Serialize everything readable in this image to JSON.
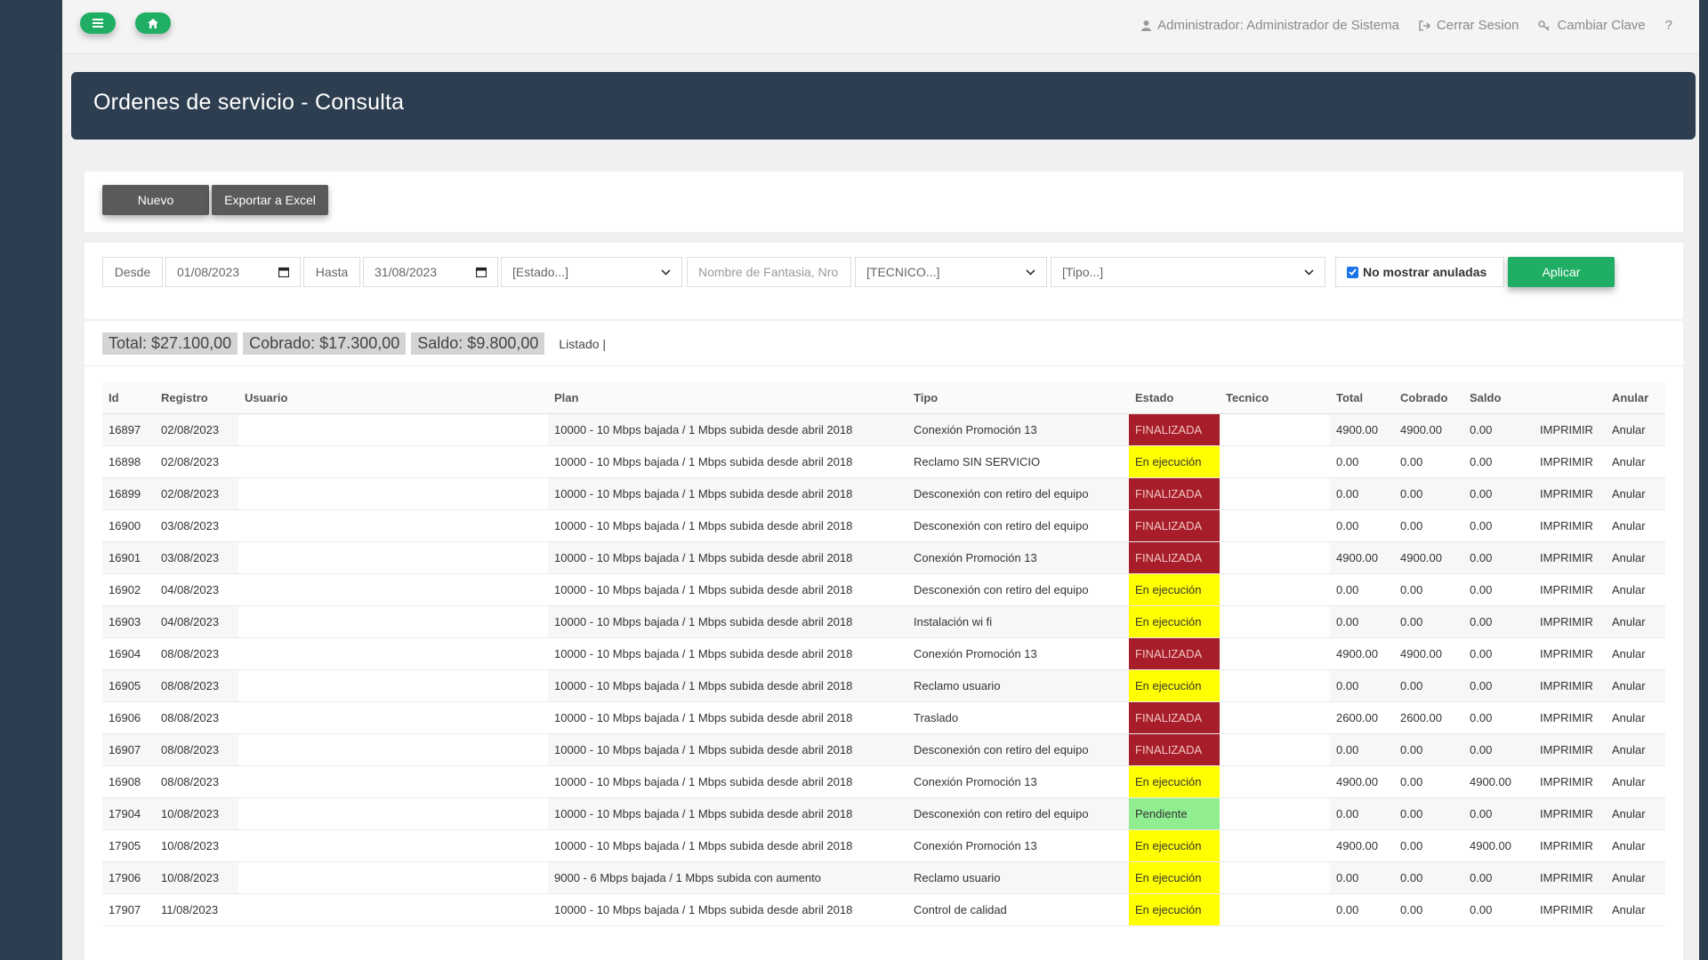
{
  "topnav": {
    "user": "Administrador: Administrador de Sistema",
    "logout": "Cerrar Sesion",
    "change_password": "Cambiar Clave",
    "help": "?"
  },
  "page": {
    "title": "Ordenes de servicio - Consulta"
  },
  "actions": {
    "new": "Nuevo",
    "export": "Exportar a Excel"
  },
  "filters": {
    "desde_label": "Desde",
    "desde_value": "01/08/2023",
    "hasta_label": "Hasta",
    "hasta_value": "31/08/2023",
    "estado": "[Estado...]",
    "search_placeholder": "Nombre de Fantasia, Nro",
    "tecnico": "[TECNICO...]",
    "tipo": "[Tipo...]",
    "no_anuladas": "No mostrar anuladas",
    "apply": "Aplicar"
  },
  "summary": {
    "total": "Total: $27.100,00",
    "cobrado": "Cobrado: $17.300,00",
    "saldo": "Saldo: $9.800,00",
    "listado": "Listado |"
  },
  "table": {
    "headers": {
      "id": "Id",
      "registro": "Registro",
      "usuario": "Usuario",
      "plan": "Plan",
      "tipo": "Tipo",
      "estado": "Estado",
      "tecnico": "Tecnico",
      "total": "Total",
      "cobrado": "Cobrado",
      "saldo": "Saldo",
      "imprimir": "",
      "anular": "Anular"
    },
    "rows": [
      {
        "id": "16897",
        "registro": "02/08/2023",
        "usuario": "",
        "plan": "10000 - 10 Mbps bajada / 1 Mbps subida desde abril 2018",
        "tipo": "Conexión Promoción 13",
        "estado": "FINALIZADA",
        "tecnico": "",
        "total": "4900.00",
        "cobrado": "4900.00",
        "saldo": "0.00",
        "imprimir": "IMPRIMIR",
        "anular": "Anular"
      },
      {
        "id": "16898",
        "registro": "02/08/2023",
        "usuario": "",
        "plan": "10000 - 10 Mbps bajada / 1 Mbps subida desde abril 2018",
        "tipo": "Reclamo SIN SERVICIO",
        "estado": "En ejecución",
        "tecnico": "",
        "total": "0.00",
        "cobrado": "0.00",
        "saldo": "0.00",
        "imprimir": "IMPRIMIR",
        "anular": "Anular"
      },
      {
        "id": "16899",
        "registro": "02/08/2023",
        "usuario": "",
        "plan": "10000 - 10 Mbps bajada / 1 Mbps subida desde abril 2018",
        "tipo": "Desconexión con retiro del equipo",
        "estado": "FINALIZADA",
        "tecnico": "",
        "total": "0.00",
        "cobrado": "0.00",
        "saldo": "0.00",
        "imprimir": "IMPRIMIR",
        "anular": "Anular"
      },
      {
        "id": "16900",
        "registro": "03/08/2023",
        "usuario": "",
        "plan": "10000 - 10 Mbps bajada / 1 Mbps subida desde abril 2018",
        "tipo": "Desconexión con retiro del equipo",
        "estado": "FINALIZADA",
        "tecnico": "",
        "total": "0.00",
        "cobrado": "0.00",
        "saldo": "0.00",
        "imprimir": "IMPRIMIR",
        "anular": "Anular"
      },
      {
        "id": "16901",
        "registro": "03/08/2023",
        "usuario": "",
        "plan": "10000 - 10 Mbps bajada / 1 Mbps subida desde abril 2018",
        "tipo": "Conexión Promoción 13",
        "estado": "FINALIZADA",
        "tecnico": "",
        "total": "4900.00",
        "cobrado": "4900.00",
        "saldo": "0.00",
        "imprimir": "IMPRIMIR",
        "anular": "Anular"
      },
      {
        "id": "16902",
        "registro": "04/08/2023",
        "usuario": "",
        "plan": "10000 - 10 Mbps bajada / 1 Mbps subida desde abril 2018",
        "tipo": "Desconexión con retiro del equipo",
        "estado": "En ejecución",
        "tecnico": "",
        "total": "0.00",
        "cobrado": "0.00",
        "saldo": "0.00",
        "imprimir": "IMPRIMIR",
        "anular": "Anular"
      },
      {
        "id": "16903",
        "registro": "04/08/2023",
        "usuario": "",
        "plan": "10000 - 10 Mbps bajada / 1 Mbps subida desde abril 2018",
        "tipo": "Instalación wi fi",
        "estado": "En ejecución",
        "tecnico": "",
        "total": "0.00",
        "cobrado": "0.00",
        "saldo": "0.00",
        "imprimir": "IMPRIMIR",
        "anular": "Anular"
      },
      {
        "id": "16904",
        "registro": "08/08/2023",
        "usuario": "",
        "plan": "10000 - 10 Mbps bajada / 1 Mbps subida desde abril 2018",
        "tipo": "Conexión Promoción 13",
        "estado": "FINALIZADA",
        "tecnico": "",
        "total": "4900.00",
        "cobrado": "4900.00",
        "saldo": "0.00",
        "imprimir": "IMPRIMIR",
        "anular": "Anular"
      },
      {
        "id": "16905",
        "registro": "08/08/2023",
        "usuario": "",
        "plan": "10000 - 10 Mbps bajada / 1 Mbps subida desde abril 2018",
        "tipo": "Reclamo usuario",
        "estado": "En ejecución",
        "tecnico": "",
        "total": "0.00",
        "cobrado": "0.00",
        "saldo": "0.00",
        "imprimir": "IMPRIMIR",
        "anular": "Anular"
      },
      {
        "id": "16906",
        "registro": "08/08/2023",
        "usuario": "",
        "plan": "10000 - 10 Mbps bajada / 1 Mbps subida desde abril 2018",
        "tipo": "Traslado",
        "estado": "FINALIZADA",
        "tecnico": "",
        "total": "2600.00",
        "cobrado": "2600.00",
        "saldo": "0.00",
        "imprimir": "IMPRIMIR",
        "anular": "Anular"
      },
      {
        "id": "16907",
        "registro": "08/08/2023",
        "usuario": "",
        "plan": "10000 - 10 Mbps bajada / 1 Mbps subida desde abril 2018",
        "tipo": "Desconexión con retiro del equipo",
        "estado": "FINALIZADA",
        "tecnico": "",
        "total": "0.00",
        "cobrado": "0.00",
        "saldo": "0.00",
        "imprimir": "IMPRIMIR",
        "anular": "Anular"
      },
      {
        "id": "16908",
        "registro": "08/08/2023",
        "usuario": "",
        "plan": "10000 - 10 Mbps bajada / 1 Mbps subida desde abril 2018",
        "tipo": "Conexión Promoción 13",
        "estado": "En ejecución",
        "tecnico": "",
        "total": "4900.00",
        "cobrado": "0.00",
        "saldo": "4900.00",
        "imprimir": "IMPRIMIR",
        "anular": "Anular"
      },
      {
        "id": "17904",
        "registro": "10/08/2023",
        "usuario": "",
        "plan": "10000 - 10 Mbps bajada / 1 Mbps subida desde abril 2018",
        "tipo": "Desconexión con retiro del equipo",
        "estado": "Pendiente",
        "tecnico": "",
        "total": "0.00",
        "cobrado": "0.00",
        "saldo": "0.00",
        "imprimir": "IMPRIMIR",
        "anular": "Anular"
      },
      {
        "id": "17905",
        "registro": "10/08/2023",
        "usuario": "",
        "plan": "10000 - 10 Mbps bajada / 1 Mbps subida desde abril 2018",
        "tipo": "Conexión Promoción 13",
        "estado": "En ejecución",
        "tecnico": "",
        "total": "4900.00",
        "cobrado": "0.00",
        "saldo": "4900.00",
        "imprimir": "IMPRIMIR",
        "anular": "Anular"
      },
      {
        "id": "17906",
        "registro": "10/08/2023",
        "usuario": "",
        "plan": "9000 - 6 Mbps bajada / 1 Mbps subida con aumento",
        "tipo": "Reclamo usuario",
        "estado": "En ejecución",
        "tecnico": "",
        "total": "0.00",
        "cobrado": "0.00",
        "saldo": "0.00",
        "imprimir": "IMPRIMIR",
        "anular": "Anular"
      },
      {
        "id": "17907",
        "registro": "11/08/2023",
        "usuario": "",
        "plan": "10000 - 10 Mbps bajada / 1 Mbps subida desde abril 2018",
        "tipo": "Control de calidad",
        "estado": "En ejecución",
        "tecnico": "",
        "total": "0.00",
        "cobrado": "0.00",
        "saldo": "0.00",
        "imprimir": "IMPRIMIR",
        "anular": "Anular"
      }
    ]
  },
  "colors": {
    "sidebar": "#2d3e50",
    "accent_green": "#1fae63",
    "finalizada": "#a71d2a",
    "en_ejecucion": "#ffff00",
    "pendiente": "#90ee90"
  },
  "icons": {
    "menu": "menu-icon",
    "home": "home-icon",
    "user": "user-icon",
    "logout": "logout-icon",
    "key": "key-icon",
    "calendar": "calendar-icon",
    "dropdown": "chevron-down-icon"
  }
}
